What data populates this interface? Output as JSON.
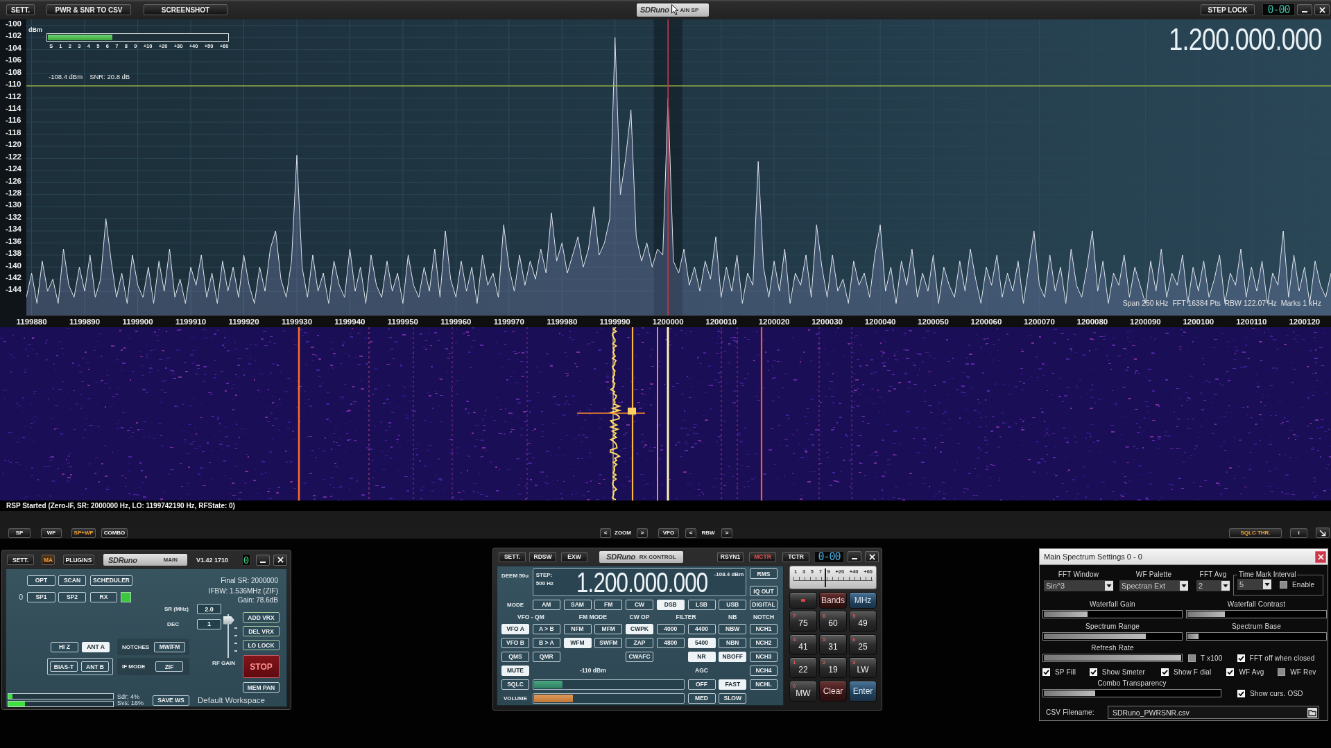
{
  "top_bar": {
    "buttons": [
      "SETT.",
      "PWR & SNR TO CSV",
      "SCREENSHOT"
    ],
    "logo": "SDRuno",
    "title": "AIN SP",
    "step_lock": "STEP LOCK",
    "counter": "0-00"
  },
  "spectrum": {
    "smeter": {
      "level": 0.36,
      "scale": [
        "S",
        "1",
        "2",
        "3",
        "4",
        "5",
        "6",
        "7",
        "8",
        "9",
        "+10",
        "+20",
        "+30",
        "+40",
        "+50",
        "+60"
      ]
    },
    "power": "-108.4 dBm",
    "snr": "SNR: 20.8 dB",
    "frequency": "1.200.000.000",
    "info": "Span 250 kHz  FFT 16384 Pts  RBW 122.07 Hz  Marks 1 kHz",
    "chart_data": {
      "type": "area",
      "ylabel": "dBm",
      "x": [
        1199879,
        1199880,
        1199881,
        1199882,
        1199883,
        1199884,
        1199885,
        1199886,
        1199887,
        1199888,
        1199889,
        1199890,
        1199891,
        1199892,
        1199893,
        1199894,
        1199895,
        1199896,
        1199897,
        1199898,
        1199899,
        1199900,
        1199901,
        1199902,
        1199903,
        1199904,
        1199905,
        1199906,
        1199907,
        1199908,
        1199909,
        1199910,
        1199911,
        1199912,
        1199913,
        1199914,
        1199915,
        1199916,
        1199917,
        1199918,
        1199919,
        1199920,
        1199921,
        1199922,
        1199923,
        1199924,
        1199925,
        1199926,
        1199927,
        1199928,
        1199929,
        1199930,
        1199931,
        1199932,
        1199933,
        1199934,
        1199935,
        1199936,
        1199937,
        1199938,
        1199939,
        1199940,
        1199941,
        1199942,
        1199943,
        1199944,
        1199945,
        1199946,
        1199947,
        1199948,
        1199949,
        1199950,
        1199951,
        1199952,
        1199953,
        1199954,
        1199955,
        1199956,
        1199957,
        1199958,
        1199959,
        1199960,
        1199961,
        1199962,
        1199963,
        1199964,
        1199965,
        1199966,
        1199967,
        1199968,
        1199969,
        1199970,
        1199971,
        1199972,
        1199973,
        1199974,
        1199975,
        1199976,
        1199977,
        1199978,
        1199979,
        1199980,
        1199981,
        1199982,
        1199983,
        1199984,
        1199985,
        1199986,
        1199987,
        1199988,
        1199989,
        1199990,
        1199991,
        1199992,
        1199993,
        1199994,
        1199995,
        1199996,
        1199997,
        1199998,
        1199999,
        1200000,
        1200001,
        1200002,
        1200003,
        1200004,
        1200005,
        1200006,
        1200007,
        1200008,
        1200009,
        1200010,
        1200011,
        1200012,
        1200013,
        1200014,
        1200015,
        1200016,
        1200017,
        1200018,
        1200019,
        1200020,
        1200021,
        1200022,
        1200023,
        1200024,
        1200025,
        1200026,
        1200027,
        1200028,
        1200029,
        1200030,
        1200031,
        1200032,
        1200033,
        1200034,
        1200035,
        1200036,
        1200037,
        1200038,
        1200039,
        1200040,
        1200041,
        1200042,
        1200043,
        1200044,
        1200045,
        1200046,
        1200047,
        1200048,
        1200049,
        1200050,
        1200051,
        1200052,
        1200053,
        1200054,
        1200055,
        1200056,
        1200057,
        1200058,
        1200059,
        1200060,
        1200061,
        1200062,
        1200063,
        1200064,
        1200065,
        1200066,
        1200067,
        1200068,
        1200069,
        1200070,
        1200071,
        1200072,
        1200073,
        1200074,
        1200075,
        1200076,
        1200077,
        1200078,
        1200079,
        1200080,
        1200081,
        1200082,
        1200083,
        1200084,
        1200085,
        1200086,
        1200087,
        1200088,
        1200089,
        1200090,
        1200091,
        1200092,
        1200093,
        1200094,
        1200095,
        1200096,
        1200097,
        1200098,
        1200099,
        1200100,
        1200101,
        1200102,
        1200103,
        1200104,
        1200105,
        1200106,
        1200107,
        1200108,
        1200109,
        1200110,
        1200111,
        1200112,
        1200113,
        1200114,
        1200115,
        1200116,
        1200117,
        1200118,
        1200119,
        1200120,
        1200121,
        1200122,
        1200123,
        1200124,
        1200125
      ],
      "values": [
        -145,
        -141,
        -146,
        -139,
        -144,
        -142,
        -146,
        -137,
        -143,
        -145,
        -140,
        -144,
        -138,
        -145,
        -142,
        -132,
        -139,
        -145,
        -141,
        -146,
        -138,
        -143,
        -145,
        -140,
        -146,
        -139,
        -144,
        -137,
        -145,
        -142,
        -146,
        -140,
        -143,
        -138,
        -145,
        -141,
        -146,
        -139,
        -144,
        -140,
        -145,
        -138,
        -143,
        -146,
        -140,
        -144,
        -137,
        -134,
        -142,
        -145,
        -139,
        -121.5,
        -140,
        -145,
        -138,
        -144,
        -141,
        -146,
        -139,
        -143,
        -145,
        -137,
        -144,
        -140,
        -146,
        -138,
        -143,
        -145,
        -139,
        -144,
        -141,
        -146,
        -138,
        -143,
        -145,
        -140,
        -144,
        -137,
        -145,
        -134,
        -142,
        -145,
        -139,
        -144,
        -140,
        -146,
        -138,
        -143,
        -141,
        -145,
        -133,
        -140,
        -144,
        -138,
        -143,
        -139,
        -142,
        -137,
        -141,
        -131,
        -139,
        -136,
        -141,
        -138,
        -135,
        -140,
        -137,
        -130,
        -138,
        -136,
        -132,
        -102,
        -128,
        -122,
        -114,
        -135,
        -139,
        -136,
        -140,
        -137,
        -138,
        -112,
        -139,
        -141,
        -137,
        -143,
        -140,
        -144,
        -139,
        -142,
        -135,
        -145,
        -140,
        -144,
        -138,
        -146,
        -141,
        -143,
        -122.5,
        -140,
        -145,
        -139,
        -144,
        -137,
        -146,
        -141,
        -143,
        -138,
        -145,
        -133,
        -140,
        -145,
        -138,
        -144,
        -142,
        -146,
        -139,
        -143,
        -141,
        -145,
        -138,
        -133,
        -144,
        -140,
        -146,
        -139,
        -143,
        -137,
        -145,
        -141,
        -144,
        -138,
        -146,
        -140,
        -143,
        -145,
        -139,
        -144,
        -137,
        -142,
        -146,
        -140,
        -143,
        -138,
        -145,
        -141,
        -144,
        -139,
        -146,
        -140,
        -134,
        -143,
        -145,
        -138,
        -144,
        -140,
        -146,
        -137,
        -143,
        -145,
        -140,
        -134,
        -144,
        -139,
        -146,
        -141,
        -143,
        -138,
        -145,
        -140,
        -143,
        -146,
        -139,
        -144,
        -137,
        -145,
        -141,
        -143,
        -138,
        -146,
        -140,
        -144,
        -139,
        -145,
        -142,
        -138,
        -146,
        -141,
        -143,
        -137,
        -145,
        -140,
        -144,
        -139,
        -146,
        -141,
        -143,
        -134,
        -145,
        -138,
        -144,
        -140,
        -146,
        -139,
        -143,
        -145,
        -141
      ],
      "xlim": [
        1199879,
        1200125
      ],
      "ylim": [
        -148,
        -99
      ],
      "xticks": [
        1199880,
        1199890,
        1199900,
        1199910,
        1199920,
        1199930,
        1199940,
        1199950,
        1199960,
        1199970,
        1199980,
        1199990,
        1200000,
        1200010,
        1200020,
        1200030,
        1200040,
        1200050,
        1200060,
        1200070,
        1200080,
        1200090,
        1200100,
        1200110,
        1200120
      ],
      "yticks": [
        -100,
        -102,
        -104,
        -106,
        -108,
        -110,
        -112,
        -114,
        -116,
        -118,
        -120,
        -122,
        -124,
        -126,
        -128,
        -130,
        -132,
        -134,
        -136,
        -138,
        -140,
        -142,
        -144
      ],
      "grid": true,
      "ref_lines": [
        {
          "axis": "y",
          "value": -110,
          "color": "#a8c43c"
        },
        {
          "axis": "x",
          "value": 1200000,
          "color": "#c23a48"
        }
      ],
      "bands": [
        {
          "axis": "x",
          "from": 1199997.3,
          "to": 1200002.7
        }
      ]
    }
  },
  "status_line": "RSP Started (Zero-IF, SR: 2000000 Hz, LO: 1199742190 Hz, RFState: 0)",
  "view_bar": {
    "views": [
      {
        "label": "SP",
        "selected": false
      },
      {
        "label": "WF",
        "selected": false
      },
      {
        "label": "SP+WF",
        "selected": true
      },
      {
        "label": "COMBO",
        "selected": false
      }
    ],
    "zoom": {
      "prev": "<",
      "label": "ZOOM",
      "next": ">"
    },
    "vfo": "VFO",
    "rbw": {
      "prev": "<",
      "label": "RBW",
      "next": ">"
    },
    "sqlc_thr": {
      "label": "SQLC THR.",
      "on": true
    },
    "info": "i"
  },
  "main_panel": {
    "title_buttons": [
      {
        "label": "SETT.",
        "on": false
      },
      {
        "label": "MA",
        "on": true
      },
      {
        "label": "PLUGINS",
        "on": false
      }
    ],
    "logo": "SDRuno",
    "title": "MAIN",
    "version": "V1.42 1710",
    "counter": "0",
    "tool_buttons": [
      "OPT",
      "SCAN",
      "SCHEDULER"
    ],
    "index": "0",
    "view_buttons": [
      "SP1",
      "SP2",
      "RX"
    ],
    "rx_on": true,
    "info": [
      "Final SR: 2000000",
      "IFBW: 1.536MHz (ZIF)",
      "Gain: 78.6dB"
    ],
    "sr": {
      "label": "SR (MHz)",
      "value": "2.0"
    },
    "dec": {
      "label": "DEC",
      "value": "1"
    },
    "rf_gain": {
      "label": "RF GAIN",
      "level": 0.95
    },
    "vrx_buttons": [
      "ADD VRX",
      "DEL VRX",
      "LO LOCK"
    ],
    "stop": "STOP",
    "mem_pan": "MEM PAN",
    "antenna": [
      {
        "label": "HI Z",
        "selected": false
      },
      {
        "label": "ANT A",
        "selected": true
      },
      {
        "label": "BIAS-T",
        "selected": false
      },
      {
        "label": "ANT B",
        "selected": false
      }
    ],
    "notches": {
      "label": "NOTCHES",
      "button": "MW/FM"
    },
    "if_mode": {
      "label": "IF MODE",
      "button": "ZIF"
    },
    "cpu": [
      {
        "label": "Sdr: 4%",
        "level": 0.04
      },
      {
        "label": "Svs: 16%",
        "level": 0.16
      }
    ],
    "save_ws": "SAVE WS",
    "workspace": "Default Workspace"
  },
  "rx_control": {
    "title_buttons": [
      {
        "label": "SETT.",
        "on": false
      },
      {
        "label": "RDSW",
        "on": false
      },
      {
        "label": "EXW",
        "on": false
      }
    ],
    "logo": "SDRuno",
    "title": "RX CONTROL",
    "right_buttons": [
      {
        "label": "RSYN1",
        "on": false
      },
      {
        "label": "MCTR",
        "on": true
      },
      {
        "label": "TCTR",
        "on": false
      }
    ],
    "counter": "0-00",
    "deem": "DEEM 50u",
    "step_label": "STEP:",
    "step": "500 Hz",
    "frequency": "1.200.000.000",
    "level": "-108.4 dBm",
    "side_buttons": [
      "RMS",
      "IQ OUT"
    ],
    "mode": {
      "label": "MODE",
      "options": [
        {
          "label": "AM",
          "selected": false
        },
        {
          "label": "SAM",
          "selected": false
        },
        {
          "label": "FM",
          "selected": false
        },
        {
          "label": "CW",
          "selected": false
        },
        {
          "label": "DSB",
          "selected": true
        },
        {
          "label": "LSB",
          "selected": false
        },
        {
          "label": "USB",
          "selected": false
        },
        {
          "label": "DIGITAL",
          "selected": false
        }
      ]
    },
    "vfo_qm": {
      "label": "VFO - QM",
      "buttons": [
        {
          "label": "VFO A",
          "selected": true
        },
        {
          "label": "A > B",
          "selected": false
        },
        {
          "label": "VFO B",
          "selected": false
        },
        {
          "label": "B > A",
          "selected": false
        },
        {
          "label": "QMS",
          "selected": false
        },
        {
          "label": "QMR",
          "selected": false
        }
      ]
    },
    "fm_mode": {
      "label": "FM MODE",
      "options": [
        {
          "label": "NFM",
          "selected": false
        },
        {
          "label": "MFM",
          "selected": false
        },
        {
          "label": "WFM",
          "selected": true
        },
        {
          "label": "SWFM",
          "selected": false
        }
      ]
    },
    "cw_op": {
      "label": "CW OP",
      "options": [
        {
          "label": "CWPK",
          "selected": true
        },
        {
          "label": "ZAP",
          "selected": false
        },
        {
          "label": "CWAFC",
          "selected": false
        }
      ]
    },
    "filter": {
      "label": "FILTER",
      "options": [
        {
          "label": "4000",
          "selected": false
        },
        {
          "label": "4400",
          "selected": false
        },
        {
          "label": "4800",
          "selected": false
        },
        {
          "label": "5400",
          "selected": true
        }
      ]
    },
    "nr": {
      "label": "NR",
      "on": true
    },
    "nb": {
      "label": "NB",
      "options": [
        {
          "label": "NBW",
          "selected": false
        },
        {
          "label": "NBN",
          "selected": false
        },
        {
          "label": "NBOFF",
          "selected": true
        }
      ]
    },
    "notch": {
      "label": "NOTCH",
      "options": [
        {
          "label": "NCH1",
          "selected": false
        },
        {
          "label": "NCH2",
          "selected": false
        },
        {
          "label": "NCH3",
          "selected": false
        },
        {
          "label": "NCH4",
          "selected": false
        },
        {
          "label": "NCHL",
          "selected": false
        }
      ]
    },
    "mute": {
      "label": "MUTE",
      "on": true
    },
    "sqlc": {
      "label": "SQLC",
      "on": false
    },
    "squelch": {
      "label": "-110 dBm",
      "level": 0.19
    },
    "volume": {
      "label": "VOLUME",
      "level": 0.26
    },
    "agc": {
      "label": "AGC",
      "options": [
        {
          "label": "OFF",
          "selected": false
        },
        {
          "label": "FAST",
          "selected": true
        },
        {
          "label": "MED",
          "selected": false
        },
        {
          "label": "SLOW",
          "selected": false
        }
      ]
    },
    "meter": {
      "scale": [
        "1",
        "3",
        "5",
        "7",
        "9",
        "+20",
        "+40",
        "+60"
      ],
      "level": 0.38
    },
    "keypad": [
      {
        "kind": "dot"
      },
      {
        "kind": "red",
        "label": "Bands"
      },
      {
        "kind": "blue",
        "label": "MHz"
      },
      {
        "kind": "number",
        "digit": "7",
        "label": "75"
      },
      {
        "kind": "number",
        "digit": "8",
        "label": "60"
      },
      {
        "kind": "number",
        "digit": "9",
        "label": "49"
      },
      {
        "kind": "number",
        "digit": "4",
        "label": "41"
      },
      {
        "kind": "number",
        "digit": "5",
        "label": "31"
      },
      {
        "kind": "number",
        "digit": "6",
        "label": "25"
      },
      {
        "kind": "number",
        "digit": "1",
        "label": "22"
      },
      {
        "kind": "number",
        "digit": "2",
        "label": "19"
      },
      {
        "kind": "number",
        "digit": "3",
        "label": "LW"
      },
      {
        "kind": "number",
        "digit": "0",
        "label": "MW"
      },
      {
        "kind": "red",
        "label": "Clear"
      },
      {
        "kind": "blue",
        "label": "Enter"
      }
    ]
  },
  "spectrum_settings": {
    "title": "Main Spectrum Settings 0 - 0",
    "dropdowns": [
      {
        "label": "FFT Window",
        "value": "Sin^3"
      },
      {
        "label": "WF Palette",
        "value": "Spectran Ext"
      },
      {
        "label": "FFT Avg",
        "value": "2"
      }
    ],
    "time_mark": {
      "label": "Time Mark Interval",
      "value": "5",
      "enable": {
        "label": "Enable",
        "checked": false
      }
    },
    "sliders": [
      {
        "label": "Waterfall Gain",
        "level": 0.32
      },
      {
        "label": "Waterfall Contrast",
        "level": 0.27
      },
      {
        "label": "Spectrum Range",
        "level": 0.74
      },
      {
        "label": "Spectrum Base",
        "level": 0.08
      }
    ],
    "refresh": {
      "label": "Refresh Rate",
      "level": 1
    },
    "refresh_checks": [
      {
        "label": "T x100",
        "checked": false
      },
      {
        "label": "FFT off when closed",
        "checked": true
      }
    ],
    "checks": [
      {
        "label": "SP Fill",
        "checked": true
      },
      {
        "label": "Show Smeter",
        "checked": true
      },
      {
        "label": "Show F dial",
        "checked": true
      },
      {
        "label": "WF Avg",
        "checked": true
      },
      {
        "label": "WF Rev",
        "checked": false
      }
    ],
    "combo": {
      "label": "Combo Transparency",
      "level": 0.29
    },
    "osd": {
      "label": "Show curs. OSD",
      "checked": true
    },
    "csv": {
      "label": "CSV Filename:",
      "value": "SDRuno_PWRSNR.csv"
    }
  }
}
